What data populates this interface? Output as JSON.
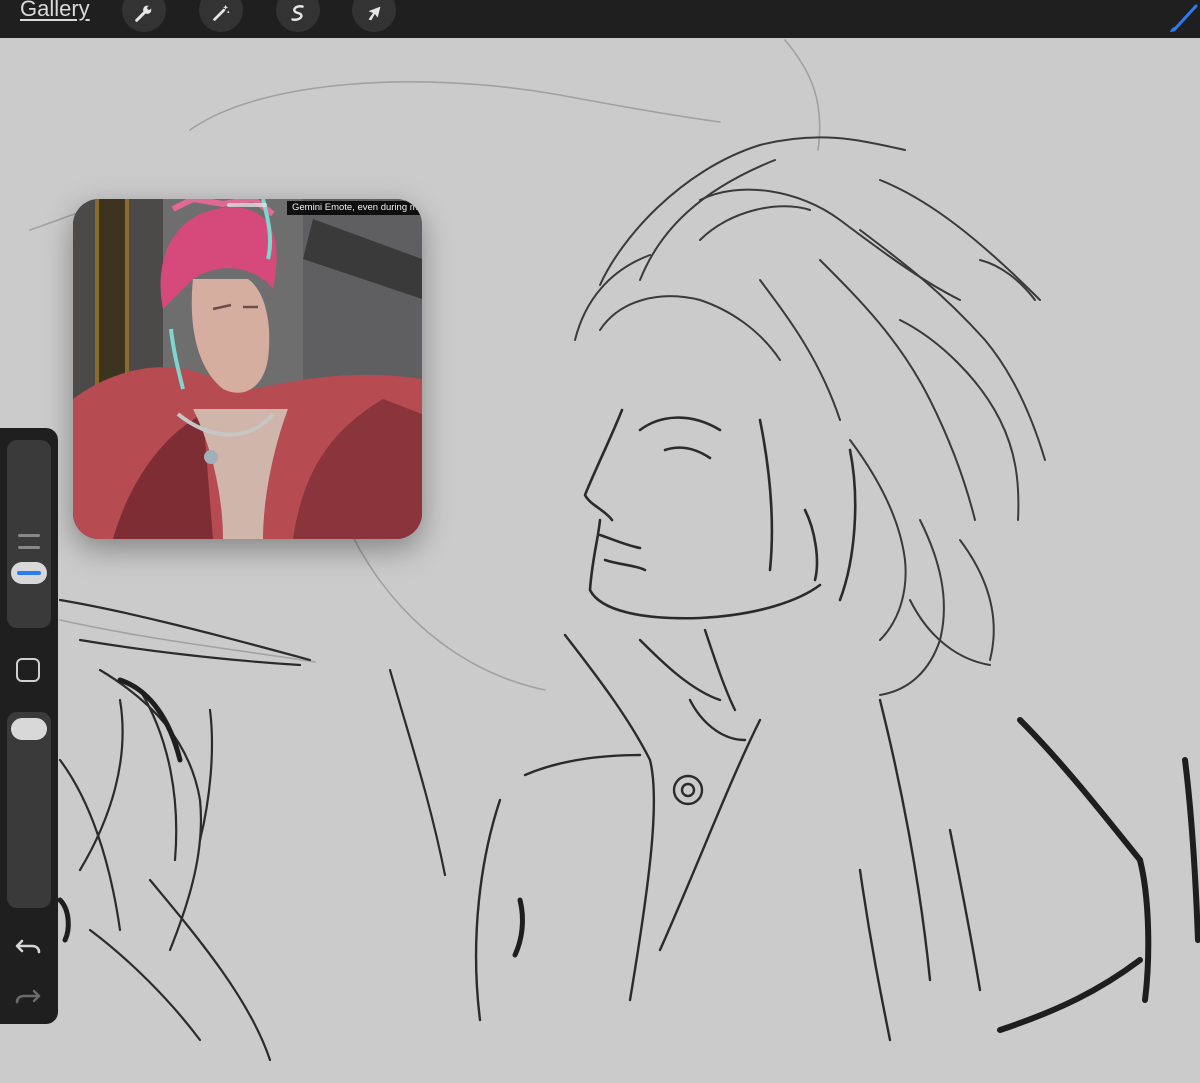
{
  "toolbar": {
    "gallery_label": "Gallery",
    "tools": [
      {
        "name": "actions",
        "icon": "wrench-icon"
      },
      {
        "name": "adjustments",
        "icon": "magic-wand-icon"
      },
      {
        "name": "selection",
        "icon": "selection-s-icon"
      },
      {
        "name": "transform",
        "icon": "arrow-cursor-icon"
      }
    ],
    "brush_icon": "brush-icon",
    "brush_color": "#2a7bf5"
  },
  "reference": {
    "caption": "Gemini Emote, even during mis"
  },
  "sidebar": {
    "size_icon": "brush-size-slider",
    "opacity_icon": "opacity-slider",
    "modify_icon": "square-modify-icon",
    "undo_icon": "undo-icon",
    "redo_icon": "redo-icon",
    "accent_color": "#2a7bf5"
  },
  "colors": {
    "canvas": "#cbcbcb",
    "ui_dark": "#1f1f1f",
    "sketch": "#2b2b2b"
  }
}
